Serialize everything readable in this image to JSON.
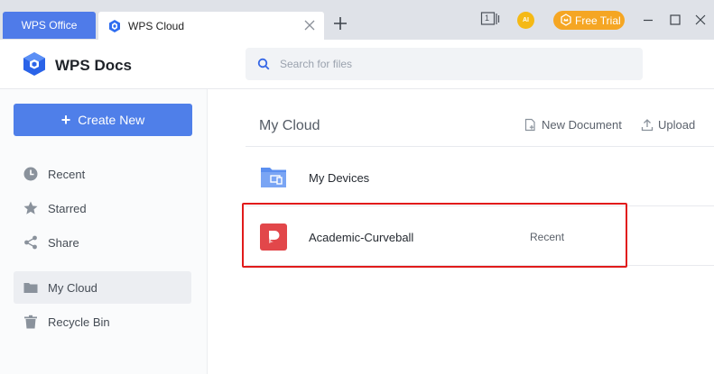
{
  "tabs": {
    "office_label": "WPS Office",
    "cloud_label": "WPS Cloud"
  },
  "titlebar": {
    "ai_label": "AI",
    "free_trial_label": "Free Trial",
    "page_indicator": "1"
  },
  "header": {
    "app_title": "WPS Docs",
    "search_placeholder": "Search for files"
  },
  "sidebar": {
    "create_label": "Create New",
    "items": [
      {
        "label": "Recent",
        "icon": "clock-icon"
      },
      {
        "label": "Starred",
        "icon": "star-icon"
      },
      {
        "label": "Share",
        "icon": "share-icon"
      },
      {
        "label": "My Cloud",
        "icon": "folder-icon",
        "active": true
      },
      {
        "label": "Recycle Bin",
        "icon": "trash-icon"
      }
    ]
  },
  "main": {
    "title": "My Cloud",
    "new_document_label": "New Document",
    "upload_label": "Upload",
    "rows": [
      {
        "name": "My Devices",
        "meta": "",
        "icon": "devices-folder-icon"
      },
      {
        "name": "Academic-Curveball",
        "meta": "Recent",
        "icon": "presentation-file-icon"
      }
    ]
  },
  "colors": {
    "accent": "#4f7fe9",
    "tab_active": "#4f7be9",
    "free_trial": "#f5a623",
    "highlight": "#e11b1b",
    "file_icon": "#e2474a"
  }
}
